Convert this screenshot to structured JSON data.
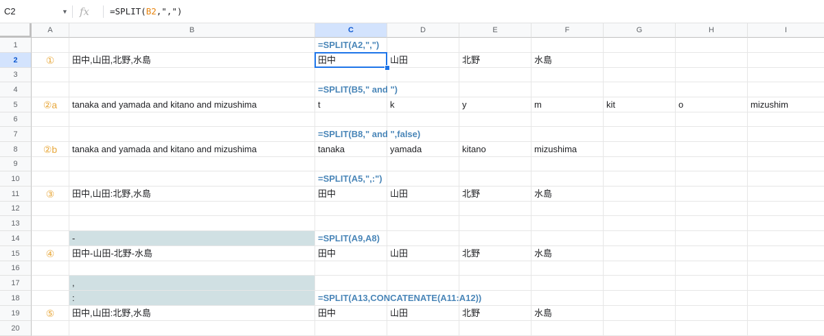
{
  "namebox": "C2",
  "formula_bar": {
    "fx_label": "fx",
    "formula_prefix": "=SPLIT(",
    "formula_ref": "B2",
    "formula_suffix": ",\",\")"
  },
  "columns": [
    "A",
    "B",
    "C",
    "D",
    "E",
    "F",
    "G",
    "H",
    "I"
  ],
  "rows": [
    "1",
    "2",
    "3",
    "4",
    "5",
    "6",
    "7",
    "8",
    "9",
    "10",
    "11",
    "12",
    "13",
    "14",
    "15",
    "16",
    "17",
    "18",
    "19",
    "20"
  ],
  "selected_cell": {
    "col": "C",
    "row": "2"
  },
  "cells": [
    {
      "ref": "C1",
      "text": "=SPLIT(A2,\",\")",
      "kind": "note"
    },
    {
      "ref": "A2",
      "text": "①",
      "kind": "marker"
    },
    {
      "ref": "B2",
      "text": "田中,山田,北野,水島"
    },
    {
      "ref": "C2",
      "text": "田中"
    },
    {
      "ref": "D2",
      "text": "山田"
    },
    {
      "ref": "E2",
      "text": "北野"
    },
    {
      "ref": "F2",
      "text": "水島"
    },
    {
      "ref": "C4",
      "text": "=SPLIT(B5,\" and \")",
      "kind": "note"
    },
    {
      "ref": "A5",
      "text": "②a",
      "kind": "marker"
    },
    {
      "ref": "B5",
      "text": "tanaka and yamada and kitano and mizushima"
    },
    {
      "ref": "C5",
      "text": "t"
    },
    {
      "ref": "D5",
      "text": "k"
    },
    {
      "ref": "E5",
      "text": "y"
    },
    {
      "ref": "F5",
      "text": "m"
    },
    {
      "ref": "G5",
      "text": "kit"
    },
    {
      "ref": "H5",
      "text": "o"
    },
    {
      "ref": "I5",
      "text": "mizushim"
    },
    {
      "ref": "C7",
      "text": "=SPLIT(B8,\" and \",false)",
      "kind": "note"
    },
    {
      "ref": "A8",
      "text": "②b",
      "kind": "marker"
    },
    {
      "ref": "B8",
      "text": "tanaka and yamada and kitano and mizushima"
    },
    {
      "ref": "C8",
      "text": "tanaka"
    },
    {
      "ref": "D8",
      "text": "yamada"
    },
    {
      "ref": "E8",
      "text": "kitano"
    },
    {
      "ref": "F8",
      "text": "mizushima"
    },
    {
      "ref": "C10",
      "text": "=SPLIT(A5,\",:\")",
      "kind": "note"
    },
    {
      "ref": "A11",
      "text": "③",
      "kind": "marker"
    },
    {
      "ref": "B11",
      "text": "田中,山田:北野,水島"
    },
    {
      "ref": "C11",
      "text": "田中"
    },
    {
      "ref": "D11",
      "text": "山田"
    },
    {
      "ref": "E11",
      "text": "北野"
    },
    {
      "ref": "F11",
      "text": "水島"
    },
    {
      "ref": "B14",
      "text": "-",
      "kind": "shade"
    },
    {
      "ref": "C14",
      "text": "=SPLIT(A9,A8)",
      "kind": "note"
    },
    {
      "ref": "A15",
      "text": "④",
      "kind": "marker"
    },
    {
      "ref": "B15",
      "text": "田中-山田-北野-水島"
    },
    {
      "ref": "C15",
      "text": "田中"
    },
    {
      "ref": "D15",
      "text": "山田"
    },
    {
      "ref": "E15",
      "text": "北野"
    },
    {
      "ref": "F15",
      "text": "水島"
    },
    {
      "ref": "B17",
      "text": ",",
      "kind": "shade"
    },
    {
      "ref": "B18",
      "text": ":",
      "kind": "shade"
    },
    {
      "ref": "C18",
      "text": "=SPLIT(A13,CONCATENATE(A11:A12))",
      "kind": "note"
    },
    {
      "ref": "A19",
      "text": "⑤",
      "kind": "marker"
    },
    {
      "ref": "B19",
      "text": "田中,山田:北野,水島"
    },
    {
      "ref": "C19",
      "text": "田中"
    },
    {
      "ref": "D19",
      "text": "山田"
    },
    {
      "ref": "E19",
      "text": "北野"
    },
    {
      "ref": "F19",
      "text": "水島"
    }
  ]
}
